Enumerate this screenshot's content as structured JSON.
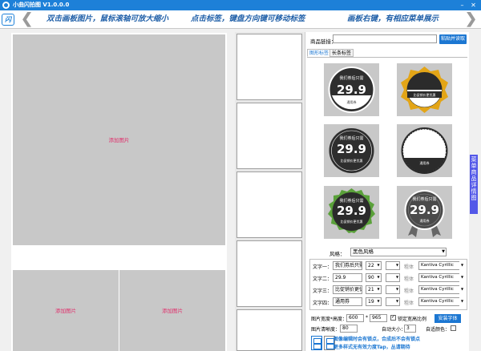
{
  "window": {
    "title": "小曲闪拍图  V1.0.0.0",
    "min_label": "–",
    "close_label": "✕"
  },
  "banner": {
    "logo_text": "闪",
    "left_arrow": "❮",
    "hints": [
      "双击画板图片，鼠标滚轴可放大缩小",
      "点击标签，键盘方向键可移动标签",
      "画板右键，有相应菜单展示"
    ],
    "right_arrow": "❯"
  },
  "canvas": {
    "main_placeholder": "添加图片",
    "bottom_left_placeholder": "添加图片",
    "bottom_right_placeholder": "添加图片"
  },
  "right_panel": {
    "url_label": "商品链接：",
    "url_value": "",
    "paste_button": "粘贴并读取",
    "tabs": [
      "图形标签",
      "长条标签"
    ],
    "badges": [
      {
        "top": "我们券后只需",
        "price": "29.9",
        "sub": "通用券",
        "variant": "black-circle"
      },
      {
        "top": "",
        "price": "",
        "sub": "比促销价更优惠",
        "variant": "gold-flower"
      },
      {
        "top": "我们券后只需",
        "price": "29.9",
        "sub": "比促销价更优惠",
        "variant": "dark-round-rect"
      },
      {
        "top": "",
        "price": "",
        "sub": "通用券",
        "variant": "dashed-white"
      },
      {
        "top": "我们券后只需",
        "price": "29.9",
        "sub": "比促销价更优惠",
        "variant": "green-gear"
      },
      {
        "top": "我们券后只需",
        "price": "29.9",
        "sub": "通用券",
        "variant": "gray-ribbon"
      }
    ],
    "style_label": "风格：",
    "style_value": "黑色风格",
    "text_rows": [
      {
        "label": "文字一：",
        "text": "我们券后只需",
        "size": "22",
        "bold": "粗体",
        "font": "Kantiva Cyrillic"
      },
      {
        "label": "文字二：",
        "text": "29.9",
        "size": "90",
        "bold": "粗体",
        "font": "Kantiva Cyrillic"
      },
      {
        "label": "文字三：",
        "text": "比促销价更优惠",
        "size": "21",
        "bold": "粗体",
        "font": "Kantiva Cyrillic"
      },
      {
        "label": "文字四：",
        "text": "通用券",
        "size": "19",
        "bold": "粗体",
        "font": "Kantiva Cyrillic"
      }
    ],
    "size_label": "图片宽度*高度：",
    "width_value": "600",
    "height_value": "965",
    "lock_ratio_label": "锁定宽高比例",
    "font_button": "安装字体",
    "clarity_label": "图片清晰度：",
    "clarity_value": "80",
    "auto_size_label": "自动大小：",
    "auto_size_value": "3",
    "auto_color_label": "自适颜色：",
    "tips": [
      "图像编辑时会有锁点，合成后不会有锁点",
      "更多样式无有效力度Tap，丛请期待"
    ]
  },
  "side_tab": {
    "label": "菜单商品详情图"
  }
}
